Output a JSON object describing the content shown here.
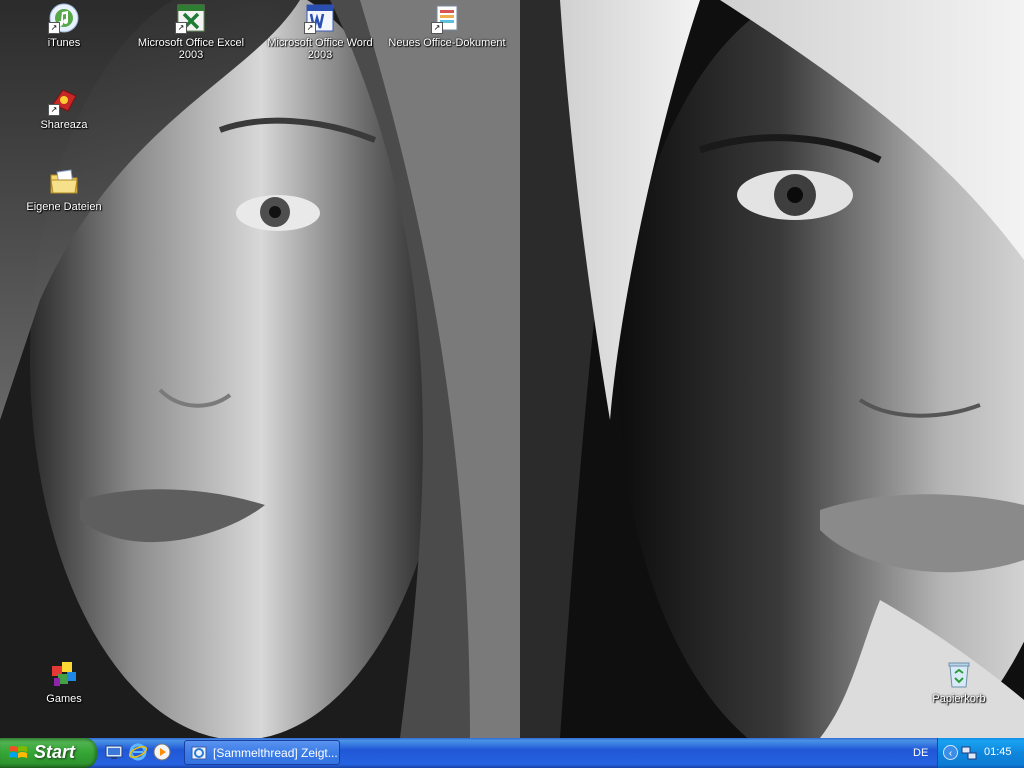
{
  "desktop": {
    "icons": [
      {
        "id": "itunes",
        "label": "iTunes",
        "icon": "itunes-icon",
        "shortcut": true
      },
      {
        "id": "excel",
        "label": "Microsoft Office Excel 2003",
        "icon": "excel-icon",
        "shortcut": true
      },
      {
        "id": "word",
        "label": "Microsoft Office Word 2003",
        "icon": "word-icon",
        "shortcut": true
      },
      {
        "id": "neues",
        "label": "Neues Office-Dokument",
        "icon": "office-document-icon",
        "shortcut": true
      },
      {
        "id": "shareaza",
        "label": "Shareaza",
        "icon": "shareaza-icon",
        "shortcut": true
      },
      {
        "id": "eigene",
        "label": "Eigene Dateien",
        "icon": "my-documents-folder-icon",
        "shortcut": false
      },
      {
        "id": "games",
        "label": "Games",
        "icon": "games-icon",
        "shortcut": false
      },
      {
        "id": "papierkorb",
        "label": "Papierkorb",
        "icon": "recycle-bin-icon",
        "shortcut": false
      }
    ]
  },
  "taskbar": {
    "start_label": "Start",
    "quick_launch": [
      "show-desktop-icon",
      "internet-explorer-icon",
      "media-player-icon"
    ],
    "task_button_label": "[Sammelthread] Zeigt...",
    "language": "DE",
    "clock": "01:45"
  },
  "colors": {
    "taskbar_blue": "#2663e0",
    "start_green": "#34a534",
    "tray_blue": "#0f86dd"
  }
}
